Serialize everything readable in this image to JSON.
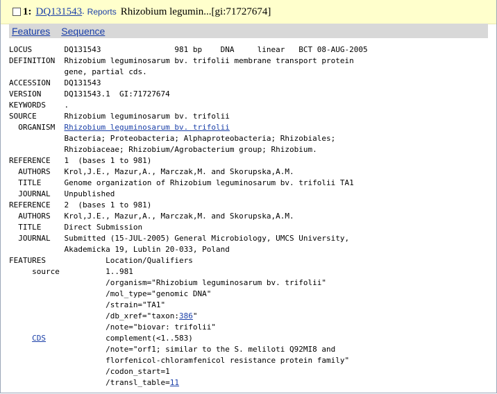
{
  "header": {
    "index": "1:",
    "accession": "DQ131543",
    "separator": ".",
    "reports": "Reports",
    "title": "Rhizobium legumin...[gi:71727674]"
  },
  "tabs": {
    "features": "Features",
    "sequence": "Sequence"
  },
  "record": {
    "locus_label": "LOCUS",
    "locus_value": "DQ131543                981 bp    DNA     linear   BCT 08-AUG-2005",
    "definition_label": "DEFINITION",
    "definition_1": "Rhizobium leguminosarum bv. trifolii membrane transport protein",
    "definition_2": "gene, partial cds.",
    "accession_label": "ACCESSION",
    "accession_value": "DQ131543",
    "version_label": "VERSION",
    "version_value": "DQ131543.1  GI:71727674",
    "keywords_label": "KEYWORDS",
    "keywords_value": ".",
    "source_label": "SOURCE",
    "source_value": "Rhizobium leguminosarum bv. trifolii",
    "organism_label": "ORGANISM",
    "organism_link": "Rhizobium leguminosarum bv. trifolii",
    "lineage_1": "Bacteria; Proteobacteria; Alphaproteobacteria; Rhizobiales;",
    "lineage_2": "Rhizobiaceae; Rhizobium/Agrobacterium group; Rhizobium.",
    "ref1_label": "REFERENCE",
    "ref1_value": "1  (bases 1 to 981)",
    "ref1_authors_label": "AUTHORS",
    "ref1_authors": "Krol,J.E., Mazur,A., Marczak,M. and Skorupska,A.M.",
    "ref1_title_label": "TITLE",
    "ref1_title": "Genome organization of Rhizobium leguminosarum bv. trifolii TA1",
    "ref1_journal_label": "JOURNAL",
    "ref1_journal": "Unpublished",
    "ref2_label": "REFERENCE",
    "ref2_value": "2  (bases 1 to 981)",
    "ref2_authors_label": "AUTHORS",
    "ref2_authors": "Krol,J.E., Mazur,A., Marczak,M. and Skorupska,A.M.",
    "ref2_title_label": "TITLE",
    "ref2_title": "Direct Submission",
    "ref2_journal_label": "JOURNAL",
    "ref2_journal_1": "Submitted (15-JUL-2005) General Microbiology, UMCS University,",
    "ref2_journal_2": "Akademicka 19, Lublin 20-033, Poland",
    "features_label": "FEATURES",
    "features_header": "Location/Qualifiers",
    "source_key": "source",
    "source_loc": "1..981",
    "q_organism": "/organism=\"Rhizobium leguminosarum bv. trifolii\"",
    "q_moltype": "/mol_type=\"genomic DNA\"",
    "q_strain": "/strain=\"TA1\"",
    "q_dbxref_pre": "/db_xref=\"taxon:",
    "q_dbxref_link": "386",
    "q_dbxref_post": "\"",
    "q_note": "/note=\"biovar: trifolii\"",
    "cds_key": "CDS",
    "cds_loc": "complement(<1..583)",
    "cds_note_1": "/note=\"orf1; similar to the S. meliloti Q92MI8 and",
    "cds_note_2": "florfenicol-chloramfenicol resistance protein family\"",
    "cds_codon": "/codon_start=1",
    "cds_transl_pre": "/transl_table=",
    "cds_transl_link": "11"
  },
  "colors": {
    "title_bg": "#ffffcc",
    "tab_bg": "#d8d8d8",
    "link": "#1a3fa8"
  }
}
